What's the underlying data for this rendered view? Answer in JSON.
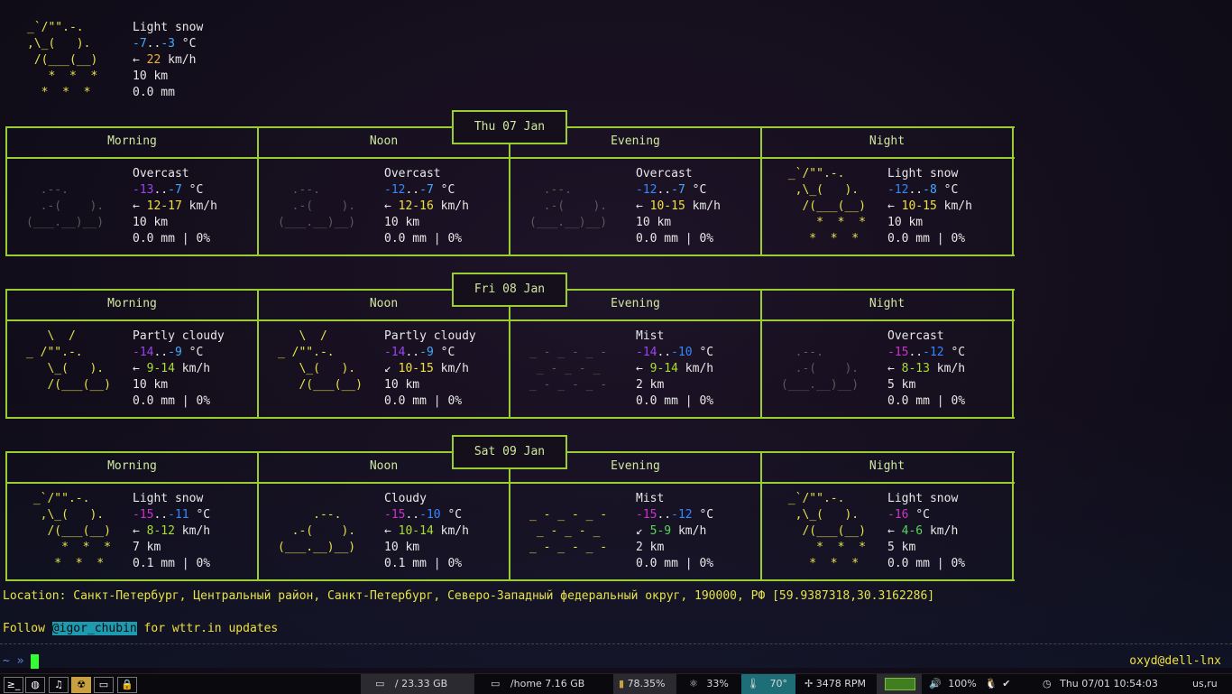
{
  "current": {
    "desc": "Light snow",
    "temp_lo": "-7",
    "temp_sep": "..",
    "temp_hi": "-3",
    "temp_unit": "°C",
    "wind_arrow": "←",
    "wind": "22",
    "wind_unit": "km/h",
    "visibility": "10 km",
    "precip": "0.0 mm",
    "art": [
      "_`/\"\".-.",
      ",\\_(   ).",
      " /(___(__)",
      "   *  *  *",
      "  *  *  *"
    ]
  },
  "periods": [
    "Morning",
    "Noon",
    "Evening",
    "Night"
  ],
  "days": [
    {
      "date": "Thu 07 Jan",
      "cells": [
        {
          "art": [
            "",
            "  .--.",
            "  .-(    ).",
            "(___.__)__)",
            ""
          ],
          "art_dim": true,
          "desc": "Overcast",
          "lo": "-13",
          "hi": "-7",
          "unit": "°C",
          "wind_arrow": "←",
          "wind": "12-17",
          "wind_unit": "km/h",
          "vis": "10 km",
          "precip": "0.0 mm | 0%"
        },
        {
          "art": [
            "",
            "  .--.",
            "  .-(    ).",
            "(___.__)__)",
            ""
          ],
          "art_dim": true,
          "desc": "Overcast",
          "lo": "-12",
          "hi": "-7",
          "unit": "°C",
          "wind_arrow": "←",
          "wind": "12-16",
          "wind_unit": "km/h",
          "vis": "10 km",
          "precip": "0.0 mm | 0%"
        },
        {
          "art": [
            "",
            "  .--.",
            "  .-(    ).",
            "(___.__)__)",
            ""
          ],
          "art_dim": true,
          "desc": "Overcast",
          "lo": "-12",
          "hi": "-7",
          "unit": "°C",
          "wind_arrow": "←",
          "wind": "10-15",
          "wind_unit": "km/h",
          "vis": "10 km",
          "precip": "0.0 mm | 0%"
        },
        {
          "art": [
            " _`/\"\".-.",
            "  ,\\_(   ).",
            "   /(___(__)",
            "     *  *  *",
            "    *  *  *"
          ],
          "art_dim": false,
          "desc": "Light snow",
          "lo": "-12",
          "hi": "-8",
          "unit": "°C",
          "wind_arrow": "←",
          "wind": "10-15",
          "wind_unit": "km/h",
          "vis": "10 km",
          "precip": "0.0 mm | 0%"
        }
      ]
    },
    {
      "date": "Fri 08 Jan",
      "cells": [
        {
          "art": [
            "   \\  /",
            "_ /\"\".-.",
            "   \\_(   ).",
            "   /(___(__)",
            ""
          ],
          "art_dim": false,
          "desc": "Partly cloudy",
          "lo": "-14",
          "hi": "-9",
          "unit": "°C",
          "wind_arrow": "←",
          "wind": "9-14",
          "wind_unit": "km/h",
          "vis": "10 km",
          "precip": "0.0 mm | 0%"
        },
        {
          "art": [
            "   \\  /",
            "_ /\"\".-.",
            "   \\_(   ).",
            "   /(___(__)",
            ""
          ],
          "art_dim": false,
          "desc": "Partly cloudy",
          "lo": "-14",
          "hi": "-9",
          "unit": "°C",
          "wind_arrow": "↙",
          "wind": "10-15",
          "wind_unit": "km/h",
          "vis": "10 km",
          "precip": "0.0 mm | 0%"
        },
        {
          "art": [
            "",
            "_ - _ - _ -",
            " _ - _ - _",
            "_ - _ - _ -",
            ""
          ],
          "art_dim": true,
          "desc": "Mist",
          "lo": "-14",
          "hi": "-10",
          "unit": "°C",
          "wind_arrow": "←",
          "wind": "9-14",
          "wind_unit": "km/h",
          "vis": "2 km",
          "precip": "0.0 mm | 0%"
        },
        {
          "art": [
            "",
            "  .--.",
            "  .-(    ).",
            "(___.__)__)",
            ""
          ],
          "art_dim": true,
          "desc": "Overcast",
          "lo": "-15",
          "hi": "-12",
          "unit": "°C",
          "wind_arrow": "←",
          "wind": "8-13",
          "wind_unit": "km/h",
          "vis": "5 km",
          "precip": "0.0 mm | 0%"
        }
      ]
    },
    {
      "date": "Sat 09 Jan",
      "cells": [
        {
          "art": [
            " _`/\"\".-.",
            "  ,\\_(   ).",
            "   /(___(__)",
            "     *  *  *",
            "    *  *  *"
          ],
          "art_dim": false,
          "desc": "Light snow",
          "lo": "-15",
          "hi": "-11",
          "unit": "°C",
          "wind_arrow": "←",
          "wind": "8-12",
          "wind_unit": "km/h",
          "vis": "7 km",
          "precip": "0.1 mm | 0%"
        },
        {
          "art": [
            "",
            "     .--.",
            "  .-(    ).",
            "(___.__)__)",
            ""
          ],
          "art_dim": false,
          "desc": "Cloudy",
          "lo": "-15",
          "hi": "-10",
          "unit": "°C",
          "wind_arrow": "←",
          "wind": "10-14",
          "wind_unit": "km/h",
          "vis": "10 km",
          "precip": "0.1 mm | 0%"
        },
        {
          "art": [
            "",
            "_ - _ - _ -",
            " _ - _ - _",
            "_ - _ - _ -",
            ""
          ],
          "art_dim": false,
          "desc": "Mist",
          "lo": "-15",
          "hi": "-12",
          "unit": "°C",
          "wind_arrow": "↙",
          "wind": "5-9",
          "wind_unit": "km/h",
          "vis": "2 km",
          "precip": "0.0 mm | 0%"
        },
        {
          "art": [
            " _`/\"\".-.",
            "  ,\\_(   ).",
            "   /(___(__)",
            "     *  *  *",
            "    *  *  *"
          ],
          "art_dim": false,
          "desc": "Light snow",
          "lo": "-16",
          "hi": "",
          "unit": "°C",
          "wind_arrow": "←",
          "wind": "4-6",
          "wind_unit": "km/h",
          "vis": "5 km",
          "precip": "0.0 mm | 0%"
        }
      ]
    }
  ],
  "location_line": "Location: Санкт-Петербург, Центральный район, Санкт-Петербург, Северо-Западный федеральный округ, 190000, РФ [59.9387318,30.3162286]",
  "follow": {
    "prefix": "Follow ",
    "handle": "@igor_chubin",
    "suffix": " for wttr.in updates"
  },
  "prompt": {
    "symbol": "~ »",
    "hostname": "oxyd@dell-lnx"
  },
  "statusbar": {
    "tags": [
      "≥_",
      "◍",
      "♫",
      "☢",
      "▭",
      "🔒"
    ],
    "disk_root": "/ 23.33 GB",
    "disk_home": "/home 7.16 GB",
    "memory": "78.35%",
    "cpu": "33%",
    "temp": "70°",
    "fan": "3478 RPM",
    "volume": "100%",
    "datetime": "Thu 07/01 10:54:03",
    "layout": "us,ru"
  }
}
